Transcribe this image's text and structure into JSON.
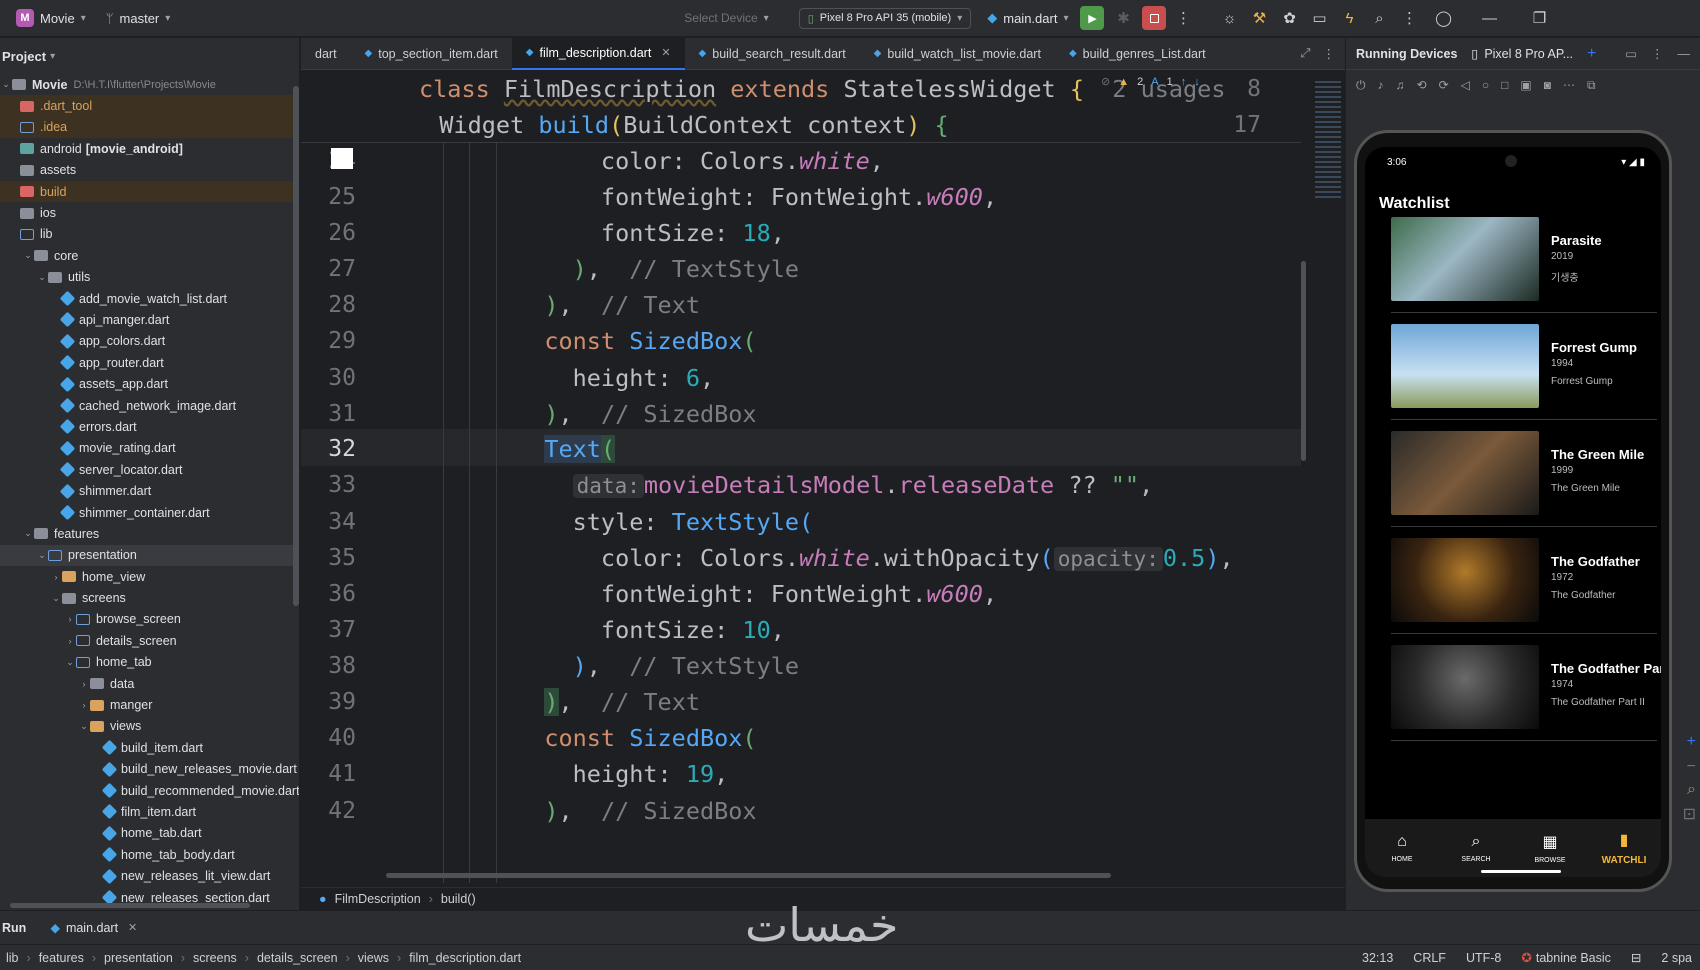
{
  "toolbar": {
    "project_badge": "M",
    "project_name": "Movie",
    "branch": "master",
    "select_device": "Select Device",
    "device": "Pixel 8 Pro API 35 (mobile)",
    "run_config": "main.dart"
  },
  "project_panel": {
    "title": "Project",
    "root_name": "Movie",
    "root_path": "D:\\H.T.I\\flutter\\Projects\\Movie",
    "items": [
      {
        "label": ".dart_tool",
        "depth": 0,
        "type": "folder-red",
        "excluded": true
      },
      {
        "label": ".idea",
        "depth": 0,
        "type": "folder-blue",
        "excluded": true
      },
      {
        "label": "android",
        "suffix": "[movie_android]",
        "depth": 0,
        "type": "folder-teal"
      },
      {
        "label": "assets",
        "depth": 0,
        "type": "folder"
      },
      {
        "label": "build",
        "depth": 0,
        "type": "folder-red",
        "excluded": true
      },
      {
        "label": "ios",
        "depth": 0,
        "type": "folder"
      },
      {
        "label": "lib",
        "depth": 0,
        "type": "folder-blue"
      },
      {
        "label": "core",
        "depth": 1,
        "type": "folder",
        "expanded": true
      },
      {
        "label": "utils",
        "depth": 2,
        "type": "folder",
        "expanded": true
      },
      {
        "label": "add_movie_watch_list.dart",
        "depth": 3,
        "type": "dart"
      },
      {
        "label": "api_manger.dart",
        "depth": 3,
        "type": "dart"
      },
      {
        "label": "app_colors.dart",
        "depth": 3,
        "type": "dart"
      },
      {
        "label": "app_router.dart",
        "depth": 3,
        "type": "dart"
      },
      {
        "label": "assets_app.dart",
        "depth": 3,
        "type": "dart"
      },
      {
        "label": "cached_network_image.dart",
        "depth": 3,
        "type": "dart"
      },
      {
        "label": "errors.dart",
        "depth": 3,
        "type": "dart"
      },
      {
        "label": "movie_rating.dart",
        "depth": 3,
        "type": "dart"
      },
      {
        "label": "server_locator.dart",
        "depth": 3,
        "type": "dart"
      },
      {
        "label": "shimmer.dart",
        "depth": 3,
        "type": "dart"
      },
      {
        "label": "shimmer_container.dart",
        "depth": 3,
        "type": "dart"
      },
      {
        "label": "features",
        "depth": 1,
        "type": "folder",
        "expanded": true
      },
      {
        "label": "presentation",
        "depth": 2,
        "type": "folder-blue",
        "expanded": true,
        "selected": true
      },
      {
        "label": "home_view",
        "depth": 3,
        "type": "folder-gold",
        "collapsed": true
      },
      {
        "label": "screens",
        "depth": 3,
        "type": "folder",
        "expanded": true
      },
      {
        "label": "browse_screen",
        "depth": 4,
        "type": "folder-blue",
        "collapsed": true
      },
      {
        "label": "details_screen",
        "depth": 4,
        "type": "folder-blue",
        "collapsed": true
      },
      {
        "label": "home_tab",
        "depth": 4,
        "type": "folder-blue",
        "expanded": true
      },
      {
        "label": "data",
        "depth": 5,
        "type": "folder",
        "collapsed": true
      },
      {
        "label": "manger",
        "depth": 5,
        "type": "folder-gold",
        "collapsed": true
      },
      {
        "label": "views",
        "depth": 5,
        "type": "folder-gold",
        "expanded": true
      },
      {
        "label": "build_item.dart",
        "depth": 6,
        "type": "dart"
      },
      {
        "label": "build_new_releases_movie.dart",
        "depth": 6,
        "type": "dart"
      },
      {
        "label": "build_recommended_movie.dart",
        "depth": 6,
        "type": "dart"
      },
      {
        "label": "film_item.dart",
        "depth": 6,
        "type": "dart"
      },
      {
        "label": "home_tab.dart",
        "depth": 6,
        "type": "dart"
      },
      {
        "label": "home_tab_body.dart",
        "depth": 6,
        "type": "dart"
      },
      {
        "label": "new_releases_lit_view.dart",
        "depth": 6,
        "type": "dart"
      },
      {
        "label": "new_releases_section.dart",
        "depth": 6,
        "type": "dart"
      }
    ]
  },
  "tabs": [
    {
      "label": "dart",
      "active": false
    },
    {
      "label": "top_section_item.dart",
      "active": false
    },
    {
      "label": "film_description.dart",
      "active": true
    },
    {
      "label": "build_search_result.dart",
      "active": false
    },
    {
      "label": "build_watch_list_movie.dart",
      "active": false
    },
    {
      "label": "build_genres_List.dart",
      "active": false
    }
  ],
  "editor": {
    "inspections": {
      "warnings": "2",
      "typos": "1"
    },
    "sticky_header": [
      {
        "line": "8",
        "code": "class FilmDescription extends StatelessWidget {",
        "usages": "2 usages"
      },
      {
        "line": "17",
        "code": "  Widget build(BuildContext context) {"
      }
    ],
    "lines": [
      "24",
      "25",
      "26",
      "27",
      "28",
      "29",
      "30",
      "31",
      "32",
      "33",
      "34",
      "35",
      "36",
      "37",
      "38",
      "39",
      "40",
      "41",
      "42"
    ],
    "current_line": "32"
  },
  "breadcrumb": {
    "class": "FilmDescription",
    "method": "build()"
  },
  "devices": {
    "title": "Running Devices",
    "device_tab": "Pixel 8 Pro AP...",
    "phone": {
      "time": "3:06",
      "screen_title": "Watchlist",
      "movies": [
        {
          "title": "Parasite",
          "year": "2019",
          "original": "기생충"
        },
        {
          "title": "Forrest Gump",
          "year": "1994",
          "original": "Forrest Gump"
        },
        {
          "title": "The Green Mile",
          "year": "1999",
          "original": "The Green Mile"
        },
        {
          "title": "The Godfather",
          "year": "1972",
          "original": "The Godfather"
        },
        {
          "title": "The Godfather Part II",
          "year": "1974",
          "original": "The Godfather Part II"
        }
      ],
      "nav": [
        {
          "label": "HOME",
          "icon": "home-icon"
        },
        {
          "label": "SEARCH",
          "icon": "search-icon"
        },
        {
          "label": "BROWSE",
          "icon": "clapper-icon"
        },
        {
          "label": "WATCHLI",
          "icon": "bookmark-icon",
          "active": true
        }
      ]
    }
  },
  "runbar": {
    "label": "Run",
    "config": "main.dart"
  },
  "statusbar": {
    "path": [
      "lib",
      "features",
      "presentation",
      "screens",
      "details_screen",
      "views",
      "film_description.dart"
    ],
    "position": "32:13",
    "line_sep": "CRLF",
    "encoding": "UTF-8",
    "plugin": "tabnine Basic",
    "indent": "2 spa"
  },
  "watermark": "خمسات",
  "colors": {
    "accent": "#3574f0",
    "keyword": "#cf8e6d",
    "class": "#56a8f5",
    "number": "#2aacb8",
    "field": "#c77dbb",
    "comment": "#7a7e85",
    "watchlist_active": "#f2b83a"
  }
}
